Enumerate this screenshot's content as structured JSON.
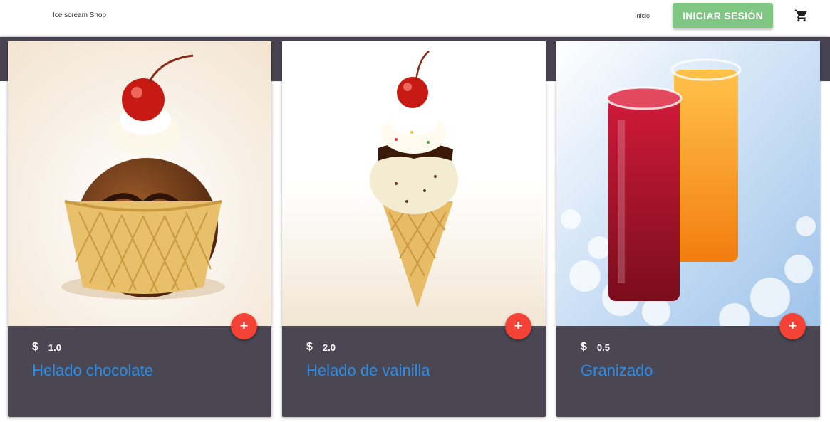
{
  "header": {
    "brand": "Ice scream Shop",
    "nav_home": "Inicio",
    "login_label": "INICIAR SESIÓN",
    "cart_icon": "shopping-cart-icon"
  },
  "products": [
    {
      "price": "1.0",
      "name": "Helado chocolate",
      "add_label": "+"
    },
    {
      "price": "2.0",
      "name": "Helado de vainilla",
      "add_label": "+"
    },
    {
      "price": "0.5",
      "name": "Granizado",
      "add_label": "+"
    }
  ],
  "colors": {
    "band": "#474350",
    "card": "#4a4652",
    "accent_button": "#81c784",
    "fab": "#f44336",
    "title": "#2d8ee8"
  },
  "icons": {
    "currency": "$"
  }
}
